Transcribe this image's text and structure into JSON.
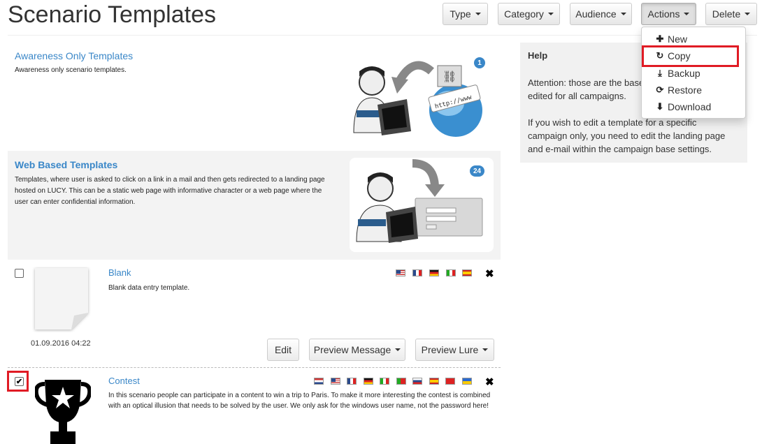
{
  "page": {
    "title": "Scenario Templates"
  },
  "toolbar": {
    "type_label": "Type",
    "category_label": "Category",
    "audience_label": "Audience",
    "actions_label": "Actions",
    "delete_label": "Delete"
  },
  "actions_menu": {
    "items": [
      {
        "label": "New",
        "icon": "plus-icon",
        "glyph": "✚"
      },
      {
        "label": "Copy",
        "icon": "copy-icon",
        "glyph": "↻"
      },
      {
        "label": "Backup",
        "icon": "download-icon",
        "glyph": "⤓"
      },
      {
        "label": "Restore",
        "icon": "restore-icon",
        "glyph": "⟳"
      },
      {
        "label": "Download",
        "icon": "circle-arrow-down-icon",
        "glyph": "⬇"
      }
    ],
    "highlighted": "Copy"
  },
  "categories": [
    {
      "title": "Awareness Only Templates",
      "description": "Awareness only scenario templates.",
      "count": "1",
      "illustration": "user-laptop-link-globe"
    },
    {
      "title": "Web Based Templates",
      "description": "Templates, where user is asked to click on a link in a mail and then gets redirected to a landing page hosted on LUCY. This can be a static web page with informative character or a web page where the user can enter confidential information.",
      "count": "24",
      "illustration": "user-laptop-login-form"
    }
  ],
  "help": {
    "title": "Help",
    "paragraph1": "Attention: those are the base templates and can be edited for all campaigns.",
    "paragraph2": "If you wish to edit a template for a specific campaign only, you need to edit the landing page and e-mail within the campaign base settings."
  },
  "templates": [
    {
      "title": "Blank",
      "description": "Blank data entry template.",
      "date": "01.09.2016 04:22",
      "checked": false,
      "flags": [
        "us",
        "fr",
        "de",
        "it",
        "es"
      ],
      "buttons": {
        "edit": "Edit",
        "preview_message": "Preview Message",
        "preview_lure": "Preview Lure"
      }
    },
    {
      "title": "Contest",
      "description": "In this scenario people can participate in a content to win a trip to Paris. To make it more interesting the contest is combined with an optical illusion that needs to be solved by the user. We only ask for the windows user name, not the password here!",
      "checked": true,
      "flags": [
        "nl",
        "us",
        "fr",
        "de",
        "it",
        "pt",
        "ru",
        "es",
        "tr",
        "ua"
      ]
    }
  ],
  "colors": {
    "link": "#3a87c8",
    "highlight": "#e01b24",
    "badge": "#3a87c8"
  }
}
